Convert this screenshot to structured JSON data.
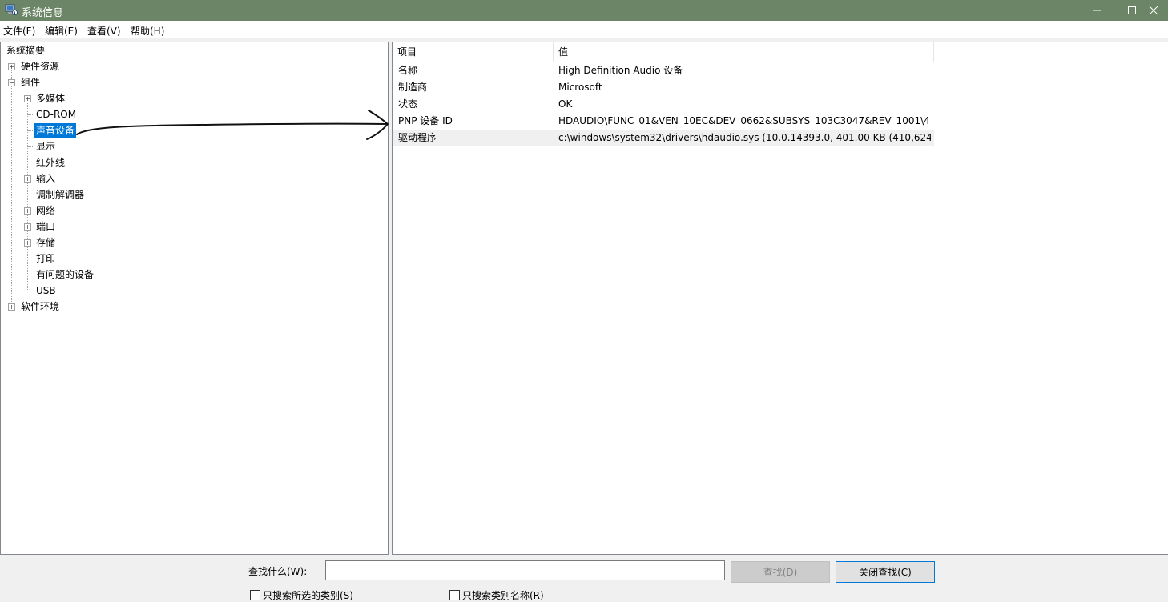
{
  "window": {
    "title": "系统信息",
    "minimize_icon": "minimize-icon",
    "maximize_icon": "maximize-icon",
    "close_icon": "close-icon"
  },
  "menu": {
    "items": [
      "文件(F)",
      "编辑(E)",
      "查看(V)",
      "帮助(H)"
    ]
  },
  "tree": {
    "root": "系统摘要",
    "hardware": "硬件资源",
    "components": "组件",
    "multimedia": "多媒体",
    "cdrom": "CD-ROM",
    "sound": "声音设备",
    "display": "显示",
    "infrared": "红外线",
    "input": "输入",
    "modem": "调制解调器",
    "network": "网络",
    "ports": "端口",
    "storage": "存储",
    "printing": "打印",
    "problem_devices": "有问题的设备",
    "usb": "USB",
    "software": "软件环境",
    "selected": "声音设备"
  },
  "details": {
    "columns": [
      "项目",
      "值"
    ],
    "rows": [
      {
        "item": "名称",
        "value": "High Definition Audio 设备"
      },
      {
        "item": "制造商",
        "value": "Microsoft"
      },
      {
        "item": "状态",
        "value": "OK"
      },
      {
        "item": "PNP 设备 ID",
        "value": "HDAUDIO\\FUNC_01&VEN_10EC&DEV_0662&SUBSYS_103C3047&REV_1001\\4..."
      },
      {
        "item": "驱动程序",
        "value": "c:\\windows\\system32\\drivers\\hdaudio.sys (10.0.14393.0, 401.00 KB (410,624 ..."
      }
    ]
  },
  "find": {
    "label": "查找什么(W):",
    "value": "",
    "find_button": "查找(D)",
    "close_button": "关闭查找(C)",
    "search_selected_label": "只搜索所选的类别(S)",
    "search_names_label": "只搜索类别名称(R)"
  },
  "colors": {
    "titlebar": "#6b8566",
    "selection": "#0078d7"
  }
}
